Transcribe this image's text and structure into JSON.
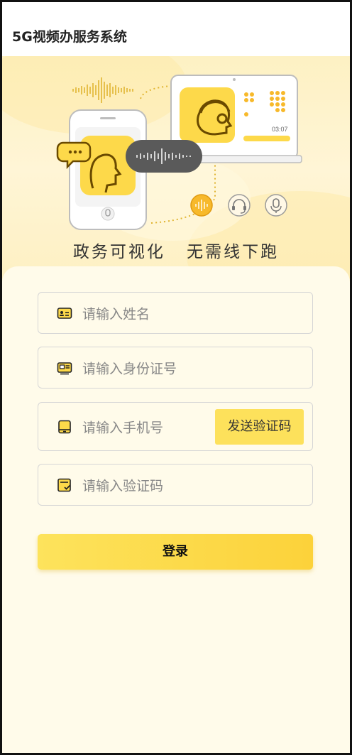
{
  "header": {
    "title": "5G视频办服务系统"
  },
  "banner": {
    "slogan_left": "政务可视化",
    "slogan_right": "无需线下跑",
    "laptop_time": "03:07"
  },
  "form": {
    "name_placeholder": "请输入姓名",
    "idcard_placeholder": "请输入身份证号",
    "phone_placeholder": "请输入手机号",
    "send_code_label": "发送验证码",
    "code_placeholder": "请输入验证码",
    "login_label": "登录"
  },
  "colors": {
    "accent": "#fde15b",
    "accent_dark": "#fcd23a",
    "icon_brown": "#6a4a00"
  }
}
